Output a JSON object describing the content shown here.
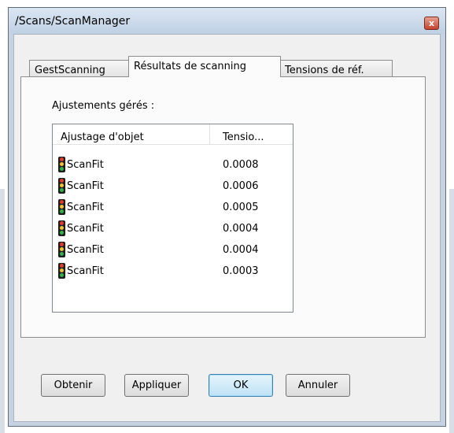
{
  "window": {
    "title": "/Scans/ScanManager",
    "close_label": "x"
  },
  "tabs": [
    {
      "label": "GestScanning"
    },
    {
      "label": "Résultats de scanning",
      "active": true
    },
    {
      "label": "Tensions de réf."
    }
  ],
  "results": {
    "group_label": "Ajustements gérés :",
    "columns": [
      "Ajustage d'objet",
      "Tensio..."
    ],
    "rows": [
      {
        "name": "ScanFit",
        "value": "0.0008"
      },
      {
        "name": "ScanFit",
        "value": "0.0006"
      },
      {
        "name": "ScanFit",
        "value": "0.0005"
      },
      {
        "name": "ScanFit",
        "value": "0.0004"
      },
      {
        "name": "ScanFit",
        "value": "0.0004"
      },
      {
        "name": "ScanFit",
        "value": "0.0003"
      }
    ],
    "row_icon": "traffic-light-icon"
  },
  "buttons": {
    "get": "Obtenir",
    "apply": "Appliquer",
    "ok": "OK",
    "cancel": "Annuler"
  },
  "colors": {
    "accent_ok": "#3c7fb1",
    "traffic_red": "#e23b2e",
    "traffic_yellow": "#f2c12e",
    "traffic_green": "#2fb34a"
  }
}
